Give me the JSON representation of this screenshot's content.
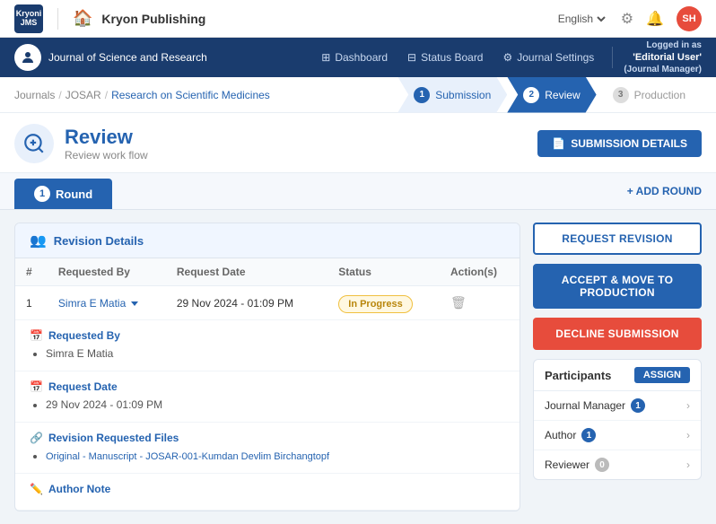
{
  "topNav": {
    "logo_line1": "Kryoni",
    "logo_line2": "JMS",
    "app_name": "Kryon Publishing",
    "language": "English",
    "avatar_initials": "SH"
  },
  "secNav": {
    "journal_name": "Journal of Science and Research",
    "links": [
      {
        "id": "dashboard",
        "label": "Dashboard",
        "icon": "grid"
      },
      {
        "id": "status-board",
        "label": "Status Board",
        "icon": "columns"
      },
      {
        "id": "journal-settings",
        "label": "Journal Settings",
        "icon": "gear"
      }
    ],
    "logged_in_label": "Logged in as",
    "logged_in_role": "'Editorial User'",
    "logged_in_sub": "(Journal Manager)"
  },
  "breadcrumb": {
    "items": [
      "Journals",
      "JOSAR",
      "Research on Scientific Medicines"
    ],
    "separators": [
      "/",
      "/"
    ]
  },
  "workflow": {
    "steps": [
      {
        "num": "1",
        "label": "Submission",
        "state": "done"
      },
      {
        "num": "2",
        "label": "Review",
        "state": "active"
      },
      {
        "num": "3",
        "label": "Production",
        "state": "inactive"
      }
    ]
  },
  "reviewHeader": {
    "title": "Review",
    "subtitle": "Review work flow",
    "submission_details_btn": "SUBMISSION DETAILS"
  },
  "roundBar": {
    "tab_label": "Round",
    "tab_num": "1",
    "add_round_btn": "+ ADD ROUND"
  },
  "revisionPanel": {
    "title": "Revision Details",
    "table": {
      "columns": [
        "#",
        "Requested By",
        "Request Date",
        "Status",
        "Action(s)"
      ],
      "rows": [
        {
          "num": "1",
          "requested_by": "Simra E Matia",
          "request_date": "29 Nov 2024 - 01:09 PM",
          "status": "In Progress",
          "has_dropdown": true
        }
      ]
    },
    "detail_sections": [
      {
        "id": "requested-by",
        "icon": "calendar",
        "title": "Requested By",
        "items": [
          "Simra E Matia"
        ]
      },
      {
        "id": "request-date",
        "icon": "calendar",
        "title": "Request Date",
        "items": [
          "29 Nov 2024 - 01:09 PM"
        ]
      },
      {
        "id": "revision-files",
        "icon": "link",
        "title": "Revision Requested Files",
        "items": [
          "Original - Manuscript - JOSAR-001-Kumdan Devlim Birchangtopf"
        ]
      },
      {
        "id": "author-note",
        "icon": "pencil",
        "title": "Author Note",
        "items": []
      }
    ]
  },
  "rightPanel": {
    "buttons": [
      {
        "id": "request-revision",
        "label": "REQUEST REVISION",
        "style": "request"
      },
      {
        "id": "accept-move",
        "label": "ACCEPT & MOVE TO PRODUCTION",
        "style": "accept"
      },
      {
        "id": "decline",
        "label": "DECLINE SUBMISSION",
        "style": "decline"
      }
    ],
    "participants": {
      "title": "Participants",
      "assign_btn": "ASSIGN",
      "items": [
        {
          "id": "journal-manager",
          "label": "Journal Manager",
          "count": "1"
        },
        {
          "id": "author",
          "label": "Author",
          "count": "1"
        },
        {
          "id": "reviewer",
          "label": "Reviewer",
          "count": "0"
        }
      ]
    }
  }
}
